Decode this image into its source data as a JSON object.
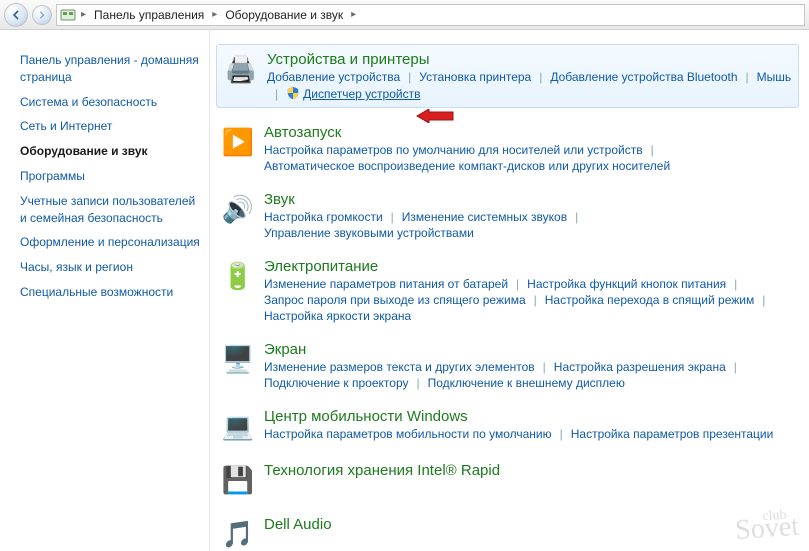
{
  "breadcrumbs": [
    "Панель управления",
    "Оборудование и звук"
  ],
  "sidebar": {
    "items": [
      {
        "label": "Панель управления - домашняя страница",
        "active": false
      },
      {
        "label": "Система и безопасность",
        "active": false
      },
      {
        "label": "Сеть и Интернет",
        "active": false
      },
      {
        "label": "Оборудование и звук",
        "active": true
      },
      {
        "label": "Программы",
        "active": false
      },
      {
        "label": "Учетные записи пользователей и семейная безопасность",
        "active": false
      },
      {
        "label": "Оформление и персонализация",
        "active": false
      },
      {
        "label": "Часы, язык и регион",
        "active": false
      },
      {
        "label": "Специальные возможности",
        "active": false
      }
    ]
  },
  "categories": [
    {
      "icon": "printer-icon",
      "glyph": "🖨️",
      "title": "Устройства и принтеры",
      "highlighted": true,
      "links": [
        {
          "label": "Добавление устройства"
        },
        {
          "label": "Установка принтера"
        },
        {
          "label": "Добавление устройства Bluetooth"
        },
        {
          "label": "Мышь"
        },
        {
          "label": "Диспетчер устройств",
          "shield": true,
          "emph": true
        }
      ]
    },
    {
      "icon": "autoplay-icon",
      "glyph": "▶️",
      "title": "Автозапуск",
      "links": [
        {
          "label": "Настройка параметров по умолчанию для носителей или устройств"
        },
        {
          "label": "Автоматическое воспроизведение компакт-дисков или других носителей"
        }
      ]
    },
    {
      "icon": "sound-icon",
      "glyph": "🔊",
      "title": "Звук",
      "links": [
        {
          "label": "Настройка громкости"
        },
        {
          "label": "Изменение системных звуков"
        },
        {
          "label": "Управление звуковыми устройствами"
        }
      ]
    },
    {
      "icon": "power-icon",
      "glyph": "🔋",
      "title": "Электропитание",
      "links": [
        {
          "label": "Изменение параметров питания от батарей"
        },
        {
          "label": "Настройка функций кнопок питания"
        },
        {
          "label": "Запрос пароля при выходе из спящего режима"
        },
        {
          "label": "Настройка перехода в спящий режим"
        },
        {
          "label": "Настройка яркости экрана"
        }
      ]
    },
    {
      "icon": "display-icon",
      "glyph": "🖥️",
      "title": "Экран",
      "links": [
        {
          "label": "Изменение размеров текста и других элементов"
        },
        {
          "label": "Настройка разрешения экрана"
        },
        {
          "label": "Подключение к проектору"
        },
        {
          "label": "Подключение к внешнему дисплею"
        }
      ]
    },
    {
      "icon": "mobility-icon",
      "glyph": "💻",
      "title": "Центр мобильности Windows",
      "links": [
        {
          "label": "Настройка параметров мобильности по умолчанию"
        },
        {
          "label": "Настройка параметров презентации"
        }
      ]
    },
    {
      "icon": "intel-rapid-icon",
      "glyph": "💾",
      "title": "Технология хранения Intel® Rapid",
      "links": []
    },
    {
      "icon": "dell-audio-icon",
      "glyph": "🎵",
      "title": "Dell Audio",
      "links": []
    }
  ],
  "watermark": {
    "small": "club",
    "big": "Sovet"
  }
}
